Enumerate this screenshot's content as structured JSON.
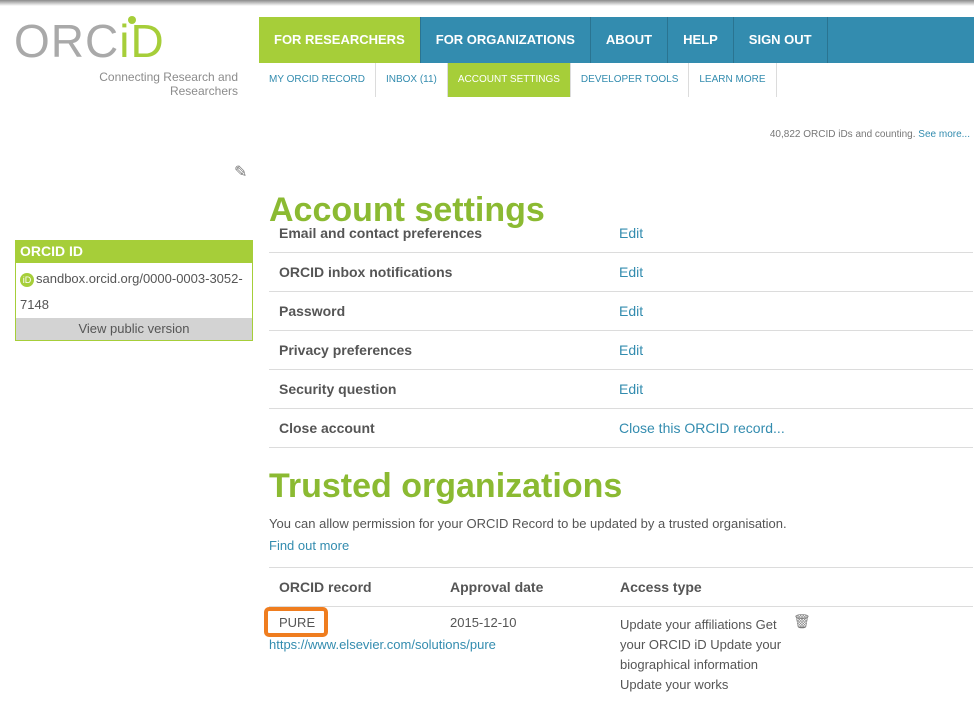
{
  "logo": {
    "text": "ORC",
    "id_part": "iD",
    "tagline": "Connecting Research and Researchers"
  },
  "main_nav": [
    "FOR RESEARCHERS",
    "FOR ORGANIZATIONS",
    "ABOUT",
    "HELP",
    "SIGN OUT"
  ],
  "sub_nav": [
    "MY ORCID RECORD",
    "INBOX (11)",
    "ACCOUNT SETTINGS",
    "DEVELOPER TOOLS",
    "LEARN MORE"
  ],
  "counter": {
    "text": "40,822 ORCID iDs and counting.",
    "link": "See more..."
  },
  "id_box": {
    "title": "ORCID ID",
    "id": "sandbox.orcid.org/0000-0003-3052-7148",
    "view": "View public version"
  },
  "settings": {
    "title": "Account settings",
    "rows": [
      {
        "label": "Email and contact preferences",
        "action": "Edit"
      },
      {
        "label": "ORCID inbox notifications",
        "action": "Edit"
      },
      {
        "label": "Password",
        "action": "Edit"
      },
      {
        "label": "Privacy preferences",
        "action": "Edit"
      },
      {
        "label": "Security question",
        "action": "Edit"
      },
      {
        "label": "Close account",
        "action": "Close this ORCID record..."
      }
    ]
  },
  "trusted": {
    "title": "Trusted organizations",
    "intro": "You can allow permission for your ORCID Record to be updated by a trusted organisation.",
    "find_out_more": "Find out more",
    "headers": [
      "ORCID record",
      "Approval date",
      "Access type"
    ],
    "org": {
      "name": "PURE",
      "url": "https://www.elsevier.com/solutions/pure",
      "date": "2015-12-10",
      "access": "Update your affiliations Get your ORCID iD Update your biographical information Update your works"
    }
  }
}
